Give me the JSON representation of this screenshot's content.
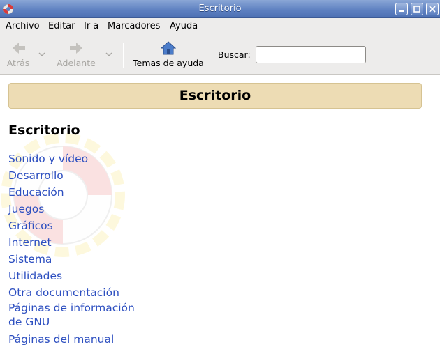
{
  "window": {
    "title": "Escritorio",
    "controls": [
      "minimize-icon",
      "maximize-icon",
      "close-icon"
    ]
  },
  "menu": [
    {
      "label": "Archivo"
    },
    {
      "label": "Editar"
    },
    {
      "label": "Ir a"
    },
    {
      "label": "Marcadores"
    },
    {
      "label": "Ayuda"
    }
  ],
  "toolbar": {
    "back_label": "Atrás",
    "forward_label": "Adelante",
    "home_label": "Temas de ayuda",
    "search_label": "Buscar:",
    "search_value": ""
  },
  "page": {
    "banner": "Escritorio",
    "heading": "Escritorio",
    "links": [
      "Sonido y vídeo",
      "Desarrollo",
      "Educación",
      "Juegos",
      "Gráficos",
      "Internet",
      "Sistema",
      "Utilidades",
      "Otra documentación",
      "Páginas de información de GNU",
      "Páginas del manual"
    ]
  },
  "colors": {
    "link": "#2d4fc0",
    "banner_bg": "#eddcb4",
    "titlebar": "#5c7fc0"
  }
}
